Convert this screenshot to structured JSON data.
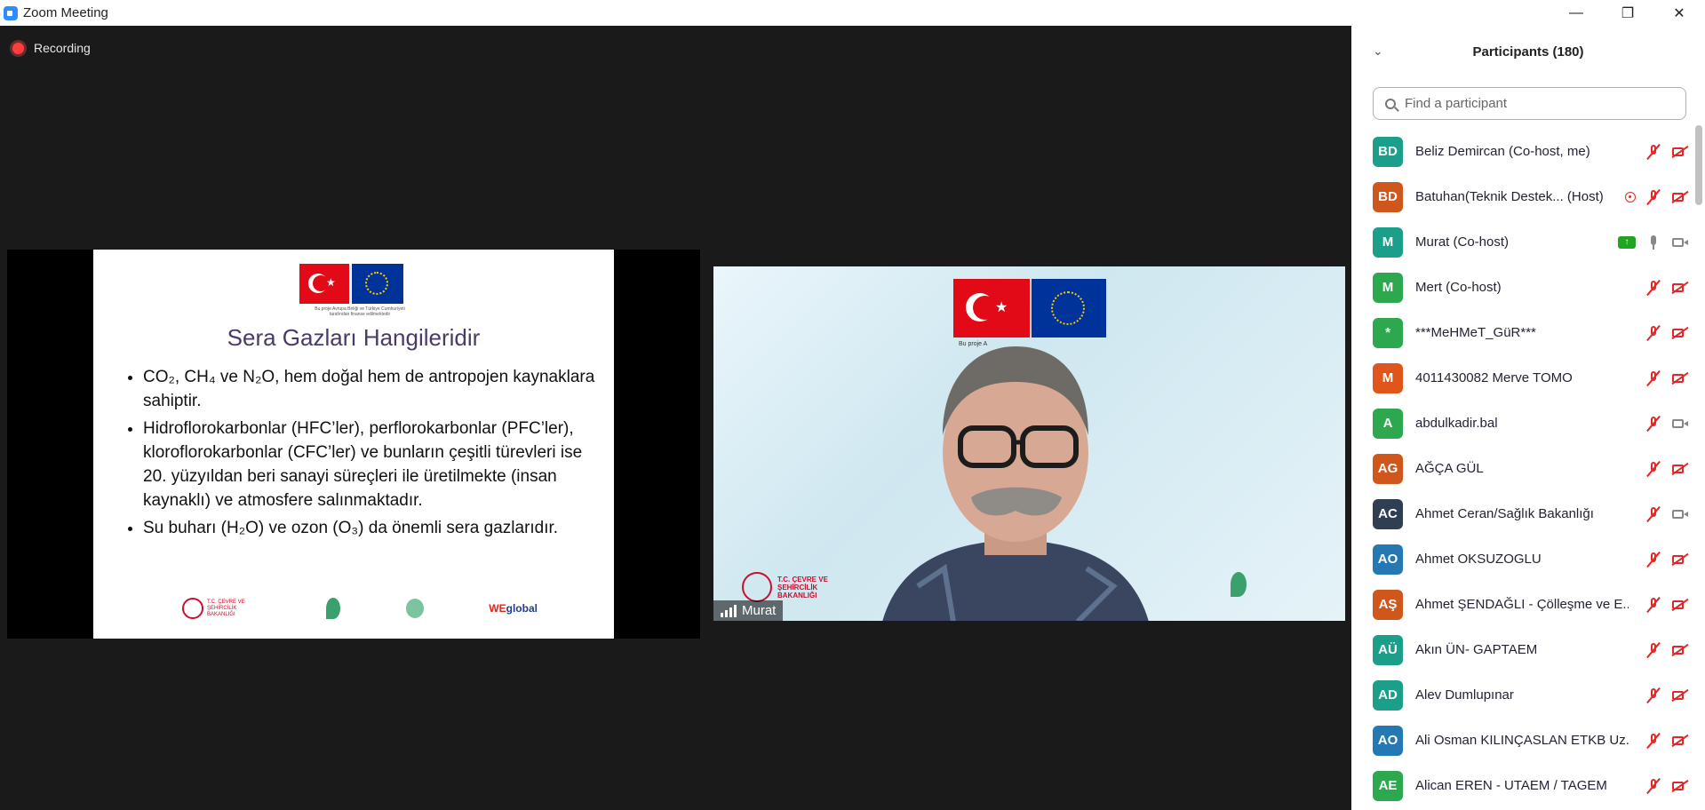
{
  "window": {
    "title": "Zoom Meeting",
    "controls": [
      "minimize",
      "restore",
      "close"
    ]
  },
  "recording": {
    "label": "Recording"
  },
  "slide": {
    "small_text": "Bu proje Avrupa Birliği ve Türkiye Cumhuriyeti tarafından finanse edilmektedir",
    "title": "Sera Gazları Hangileridir",
    "bullets": [
      "CO₂, CH₄ ve N₂O, hem doğal hem de antropojen kaynaklara sahiptir.",
      "Hidroflorokarbonlar (HFC’ler), perflorokarbonlar (PFC’ler), kloroflorokarbonlar (CFC’ler) ve bunların çeşitli türevleri ise 20. yüzyıldan beri sanayi süreçleri ile üretilmekte (insan kaynaklı) ve atmosfere salınmaktadır.",
      "Su buharı (H₂O) ve ozon (O₃) da önemli sera gazlarıdır."
    ],
    "logo_left": "T.C. ÇEVRE VE ŞEHİRCİLİK BAKANLIĞI",
    "logo_weglobal_we": "WE",
    "logo_weglobal_rest": "global"
  },
  "video": {
    "name": "Murat",
    "logo_left": "T.C. ÇEVRE VE ŞEHİRCİLİK BAKANLIĞI",
    "flag_caption": "Bu proje A"
  },
  "panel": {
    "title": "Participants (180)",
    "search_placeholder": "Find a participant",
    "participants": [
      {
        "initials": "BD",
        "name": "Beliz Demircan (Co-host, me)",
        "color": "#1b9e8a",
        "icons": [
          "mic-muted",
          "cam-muted"
        ]
      },
      {
        "initials": "BD",
        "name": "Batuhan(Teknik Destek... (Host)",
        "color": "#d0571c",
        "icons": [
          "rec-ind",
          "mic-muted",
          "cam-muted"
        ]
      },
      {
        "initials": "M",
        "name": "Murat (Co-host)",
        "color": "#1b9e8a",
        "icons": [
          "share-badge",
          "mic-on",
          "cam-on"
        ]
      },
      {
        "initials": "M",
        "name": "Mert (Co-host)",
        "color": "#2ea84f",
        "icons": [
          "mic-muted",
          "cam-muted"
        ]
      },
      {
        "initials": "*",
        "name": "***MeHMeT_GüR***",
        "color": "#2ea84f",
        "icons": [
          "mic-muted",
          "cam-muted"
        ]
      },
      {
        "initials": "M",
        "name": "4011430082 Merve TOMO",
        "color": "#e0551c",
        "icons": [
          "mic-muted",
          "cam-muted"
        ]
      },
      {
        "initials": "A",
        "name": "abdulkadir.bal",
        "color": "#2ea84f",
        "icons": [
          "mic-muted",
          "cam-on"
        ]
      },
      {
        "initials": "AG",
        "name": "AĞÇA GÜL",
        "color": "#d0571c",
        "icons": [
          "mic-muted",
          "cam-muted"
        ]
      },
      {
        "initials": "AC",
        "name": "Ahmet Ceran/Sağlık Bakanlığı",
        "color": "#2f3e52",
        "icons": [
          "mic-muted",
          "cam-on"
        ]
      },
      {
        "initials": "AO",
        "name": "Ahmet OKSUZOGLU",
        "color": "#2479b5",
        "icons": [
          "mic-muted",
          "cam-muted"
        ]
      },
      {
        "initials": "AŞ",
        "name": "Ahmet ŞENDAĞLI - Çölleşme ve E...",
        "color": "#d0571c",
        "icons": [
          "mic-muted",
          "cam-muted"
        ]
      },
      {
        "initials": "AÜ",
        "name": "Akın ÜN- GAPTAEM",
        "color": "#1b9e8a",
        "icons": [
          "mic-muted",
          "cam-muted"
        ]
      },
      {
        "initials": "AD",
        "name": "Alev Dumlupınar",
        "color": "#1b9e8a",
        "icons": [
          "mic-muted",
          "cam-muted"
        ]
      },
      {
        "initials": "AO",
        "name": "Ali Osman KILINÇASLAN ETKB Uz...",
        "color": "#2479b5",
        "icons": [
          "mic-muted",
          "cam-muted"
        ]
      },
      {
        "initials": "AE",
        "name": "Alican EREN - UTAEM / TAGEM",
        "color": "#2ea84f",
        "icons": [
          "mic-muted",
          "cam-muted"
        ]
      }
    ]
  }
}
